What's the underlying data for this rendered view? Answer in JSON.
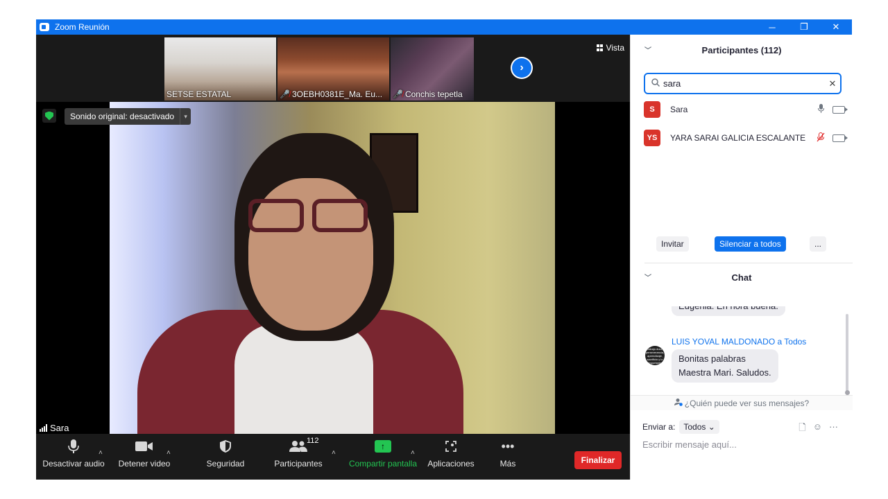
{
  "window": {
    "title": "Zoom Reunión",
    "minimize": "─",
    "restore": "❐",
    "close": "✕"
  },
  "video": {
    "thumbnails": [
      {
        "name": "SETSE ESTATAL",
        "muted": false
      },
      {
        "name": "3OEBH0381E_Ma. Eu...",
        "muted": true
      },
      {
        "name": "Conchis  tepetla",
        "muted": true
      }
    ],
    "next_arrow": "›",
    "view_label": "Vista",
    "sound_chip": "Sonido original: desactivado",
    "sound_chip_caret": "▾",
    "speaker_name": "Sara"
  },
  "toolbar": {
    "mute": "Desactivar audio",
    "video": "Detener video",
    "security": "Seguridad",
    "participants": "Participantes",
    "participants_count": "112",
    "share": "Compartir pantalla",
    "apps": "Aplicaciones",
    "more": "Más",
    "end": "Finalizar",
    "caret": "˄",
    "more_icon": "•••"
  },
  "participants_panel": {
    "header": "Participantes (112)",
    "chevron": "﹀",
    "search_value": "sara",
    "search_icon": "🔍",
    "clear_icon": "✕",
    "list": [
      {
        "initials": "S",
        "name": "Sara",
        "mic": "on",
        "color": "#d9342b"
      },
      {
        "initials": "YS",
        "name": "YARA SARAI GALICIA ESCALANTE",
        "mic": "off",
        "color": "#d9342b"
      }
    ],
    "invite": "Invitar",
    "mute_all": "Silenciar a todos",
    "more": "..."
  },
  "chat": {
    "header": "Chat",
    "chevron": "﹀",
    "prev_message_fragment": "Eugenia. En hora buena.",
    "sender": "LUIS YOVAL MALDONADO a Todos",
    "message_line1": "Bonitas palabras",
    "message_line2": "Maestra Mari. Saludos.",
    "avatar_text": "trabajo duro, perseverancia, aprendizaje, sacrificio y lo importante",
    "who_sees": "¿Quién puede ver sus mensajes?",
    "who_sees_icon": "👤",
    "send_to_label": "Enviar a:",
    "send_to_value": "Todos",
    "send_to_caret": "⌄",
    "input_placeholder": "Escribir mensaje aquí...",
    "file_icon": "🗋",
    "emoji_icon": "☺",
    "more_icon": "···"
  },
  "colors": {
    "accent": "#0e72ed",
    "danger": "#e02828",
    "success": "#23c552"
  }
}
